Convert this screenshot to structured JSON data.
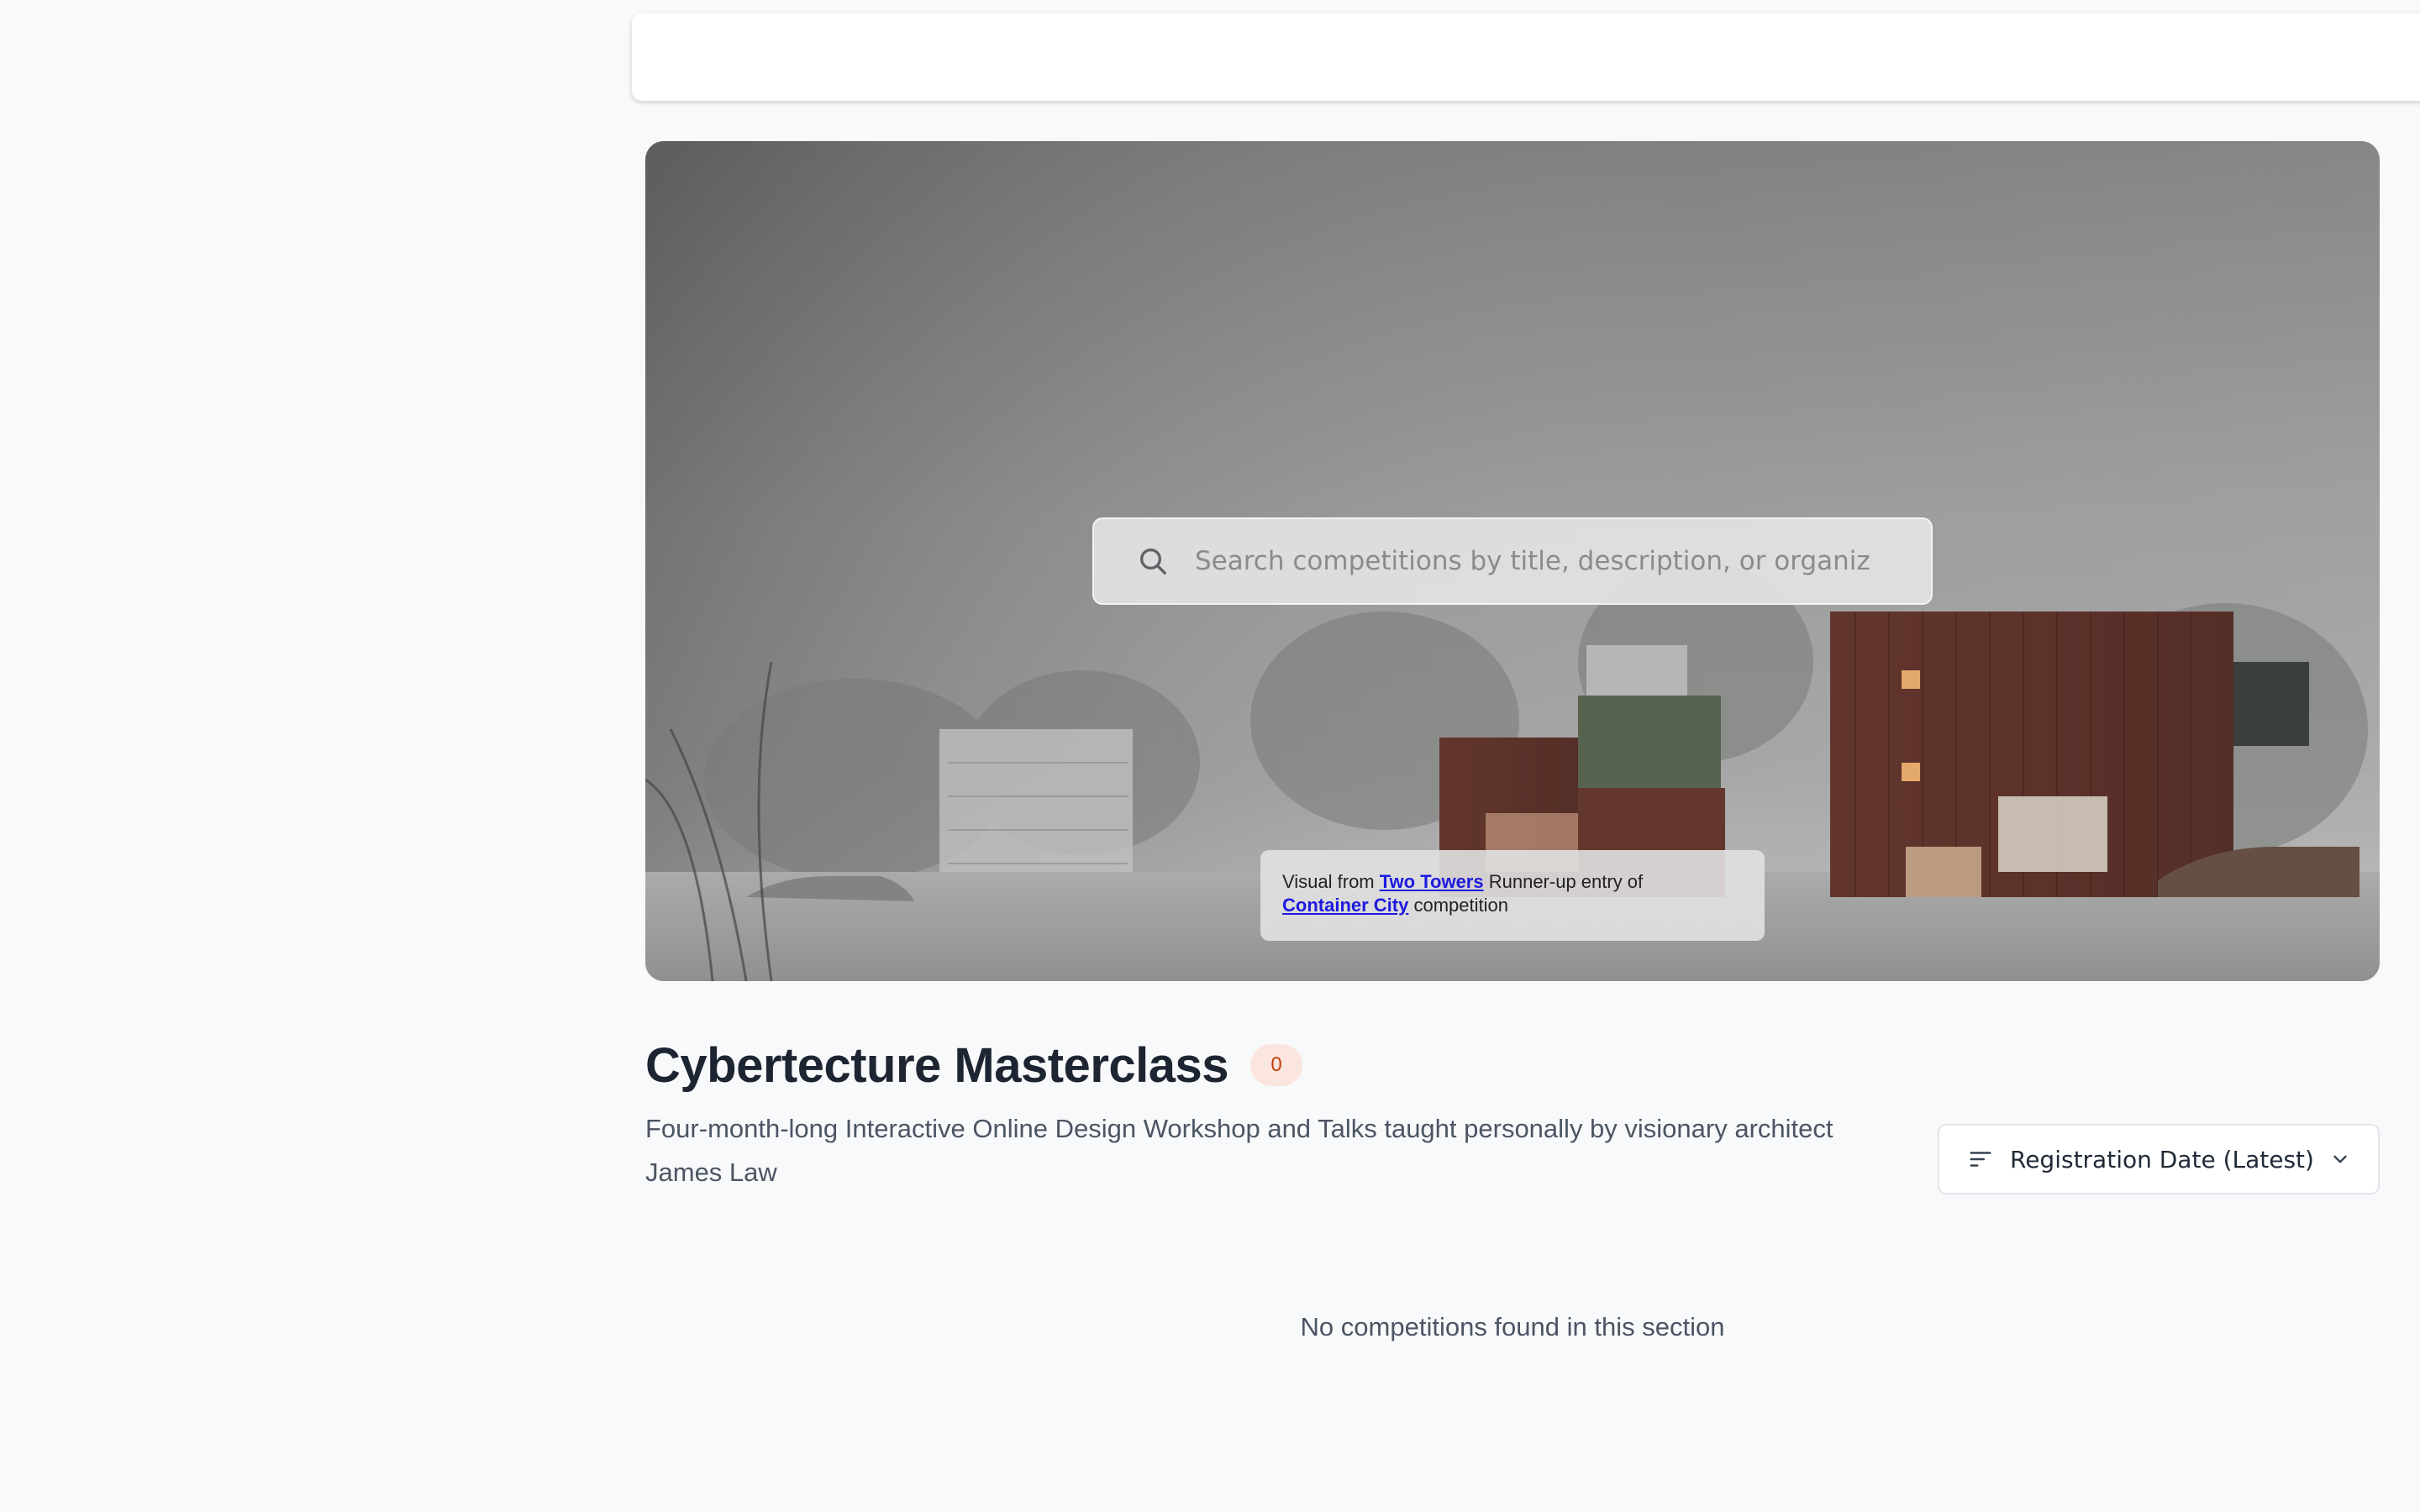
{
  "search": {
    "placeholder": "Search competitions by title, description, or organiz"
  },
  "hero_caption": {
    "prefix": "Visual from ",
    "entry_link": "Two Towers",
    "middle": " Runner-up entry of ",
    "competition_link": "Container City",
    "suffix": " competition"
  },
  "section": {
    "title": "Cybertecture Masterclass",
    "count": "0",
    "description": "Four-month-long Interactive Online Design Workshop and Talks taught personally by visionary architect James Law"
  },
  "sort": {
    "selected": "Registration Date (Latest)"
  },
  "empty_message": "No competitions found in this section",
  "colors": {
    "badge_bg": "#fbe5df",
    "badge_text": "#c2410c",
    "link": "#1d1adf",
    "title": "#1e2532"
  },
  "icons": {
    "search": "search-icon",
    "sort": "sort-lines-icon",
    "dropdown": "chevron-down-icon"
  }
}
